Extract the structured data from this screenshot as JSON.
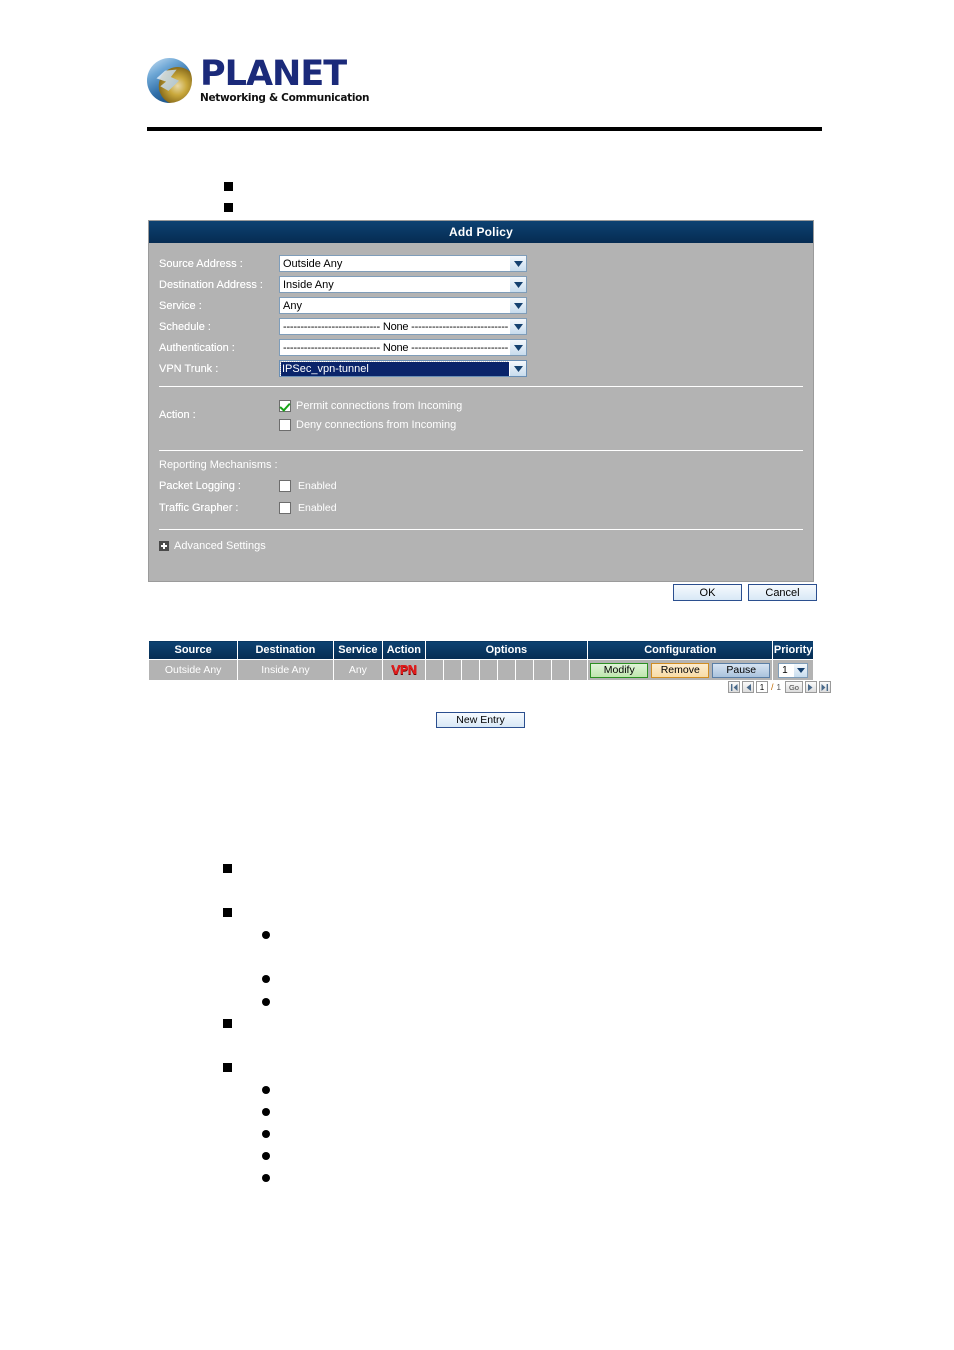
{
  "header": {
    "brand": "PLANET",
    "tagline": "Networking & Communication"
  },
  "panel": {
    "title": "Add Policy",
    "fields": [
      {
        "label": "Source Address :",
        "value": "Outside Any",
        "selected": false
      },
      {
        "label": "Destination Address :",
        "value": "Inside Any",
        "selected": false
      },
      {
        "label": "Service :",
        "value": "Any",
        "selected": false
      },
      {
        "label": "Schedule :",
        "value": "---------------------------- None ----------------------------",
        "selected": false
      },
      {
        "label": "Authentication :",
        "value": "---------------------------- None ----------------------------",
        "selected": false
      },
      {
        "label": "VPN Trunk :",
        "value": "IPSec_vpn-tunnel",
        "selected": true
      }
    ],
    "action": {
      "label": "Action :",
      "permit_label": "Permit connections from Incoming",
      "permit_checked": true,
      "deny_label": "Deny connections from Incoming",
      "deny_checked": false
    },
    "reporting": {
      "heading": "Reporting Mechanisms :",
      "packet_logging_label": "Packet Logging :",
      "packet_logging_value": "Enabled",
      "packet_logging_checked": false,
      "traffic_grapher_label": "Traffic Grapher :",
      "traffic_grapher_value": "Enabled",
      "traffic_grapher_checked": false
    },
    "advanced_settings_label": "Advanced Settings"
  },
  "buttons": {
    "ok": "OK",
    "cancel": "Cancel",
    "new_entry": "New Entry"
  },
  "policy_table": {
    "headers": {
      "source": "Source",
      "destination": "Destination",
      "service": "Service",
      "action": "Action",
      "options": "Options",
      "configuration": "Configuration",
      "priority": "Priority"
    },
    "rows": [
      {
        "source": "Outside Any",
        "destination": "Inside Any",
        "service": "Any",
        "action_badge": "VPN",
        "options": [
          "",
          "",
          "",
          "",
          "",
          "",
          "",
          ""
        ],
        "configuration": {
          "modify": "Modify",
          "remove": "Remove",
          "pause": "Pause"
        },
        "priority": "1"
      }
    ]
  },
  "pager": {
    "current_page": "1",
    "separator": "/",
    "total_pages": "1",
    "go_label": "Go"
  },
  "colors": {
    "header_navy": "#0b3c68",
    "panel_gray": "#b3b3b3",
    "vpn_red": "#e01b1b",
    "modify_green": "#2c8f22",
    "remove_orange": "#d08d22",
    "pause_blue": "#5b7fa6",
    "select_highlight": "#0a246a"
  }
}
